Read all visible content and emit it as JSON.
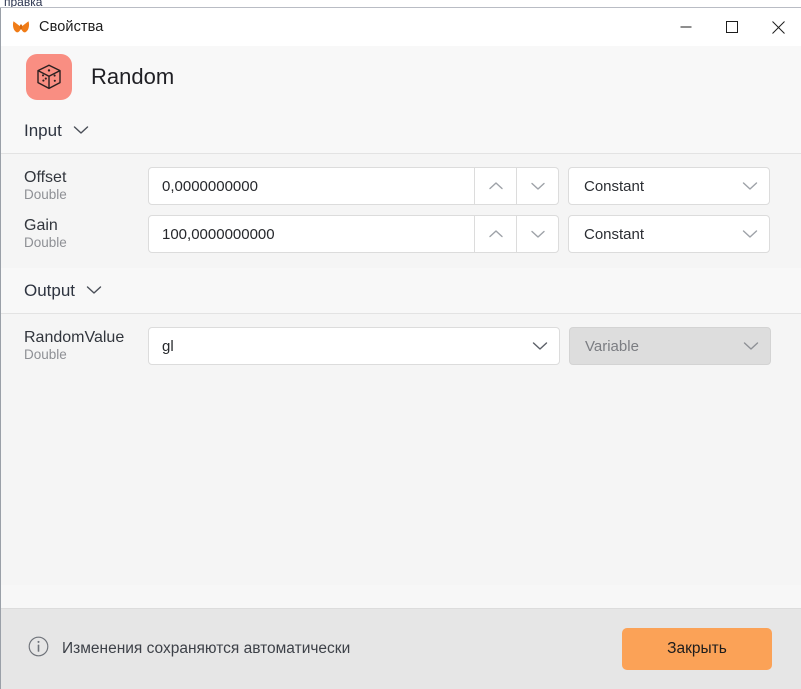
{
  "background_window": {
    "partial_text": "правка"
  },
  "titlebar": {
    "app_icon": "butterfly-logo-icon",
    "title": "Свойства",
    "minimize_label": "—",
    "maximize_label": "□",
    "close_label": "✕"
  },
  "header": {
    "icon": "dice-cube-icon",
    "icon_bg_color": "#f98e82",
    "title": "Random"
  },
  "sections": [
    {
      "label": "Input",
      "chevron": "chevron-down-icon",
      "rows": [
        {
          "name": "Offset",
          "type": "Double",
          "value": "0,0000000000",
          "spinner_up": "chevron-up-icon",
          "spinner_down": "chevron-down-icon",
          "mode": "Constant",
          "mode_chevron": "chevron-down-icon",
          "mode_disabled": false
        },
        {
          "name": "Gain",
          "type": "Double",
          "value": "100,0000000000",
          "spinner_up": "chevron-up-icon",
          "spinner_down": "chevron-down-icon",
          "mode": "Constant",
          "mode_chevron": "chevron-down-icon",
          "mode_disabled": true
        }
      ]
    },
    {
      "label": "Output",
      "chevron": "chevron-down-icon",
      "rows": [
        {
          "name": "RandomValue",
          "type": "Double",
          "value": "gl",
          "field_chevron": "chevron-down-icon",
          "mode": "Variable",
          "mode_chevron": "chevron-down-icon",
          "mode_disabled": true
        }
      ]
    }
  ],
  "footer": {
    "info_icon": "info-circle-icon",
    "message": "Изменения сохраняются автоматически",
    "close_button": "Закрыть",
    "close_button_color": "#fba257"
  }
}
